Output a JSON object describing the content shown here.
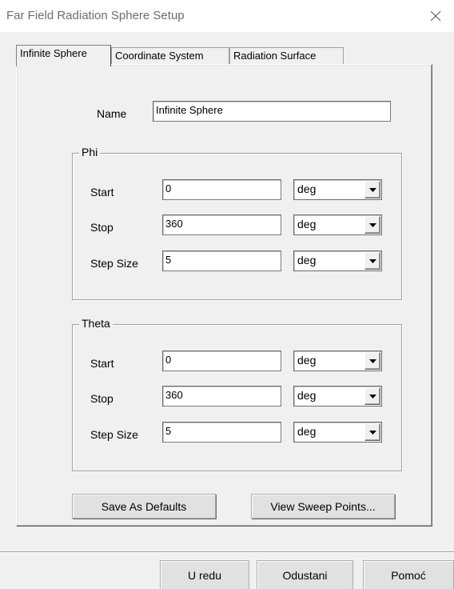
{
  "window": {
    "title": "Far Field Radiation Sphere Setup",
    "close_icon": "close-icon"
  },
  "tabs": [
    {
      "label": "Infinite Sphere",
      "active": true
    },
    {
      "label": "Coordinate System",
      "active": false
    },
    {
      "label": "Radiation Surface",
      "active": false
    }
  ],
  "name_field": {
    "label": "Name",
    "value": "Infinite Sphere"
  },
  "phi": {
    "legend": "Phi",
    "start": {
      "label": "Start",
      "value": "0",
      "unit": "deg"
    },
    "stop": {
      "label": "Stop",
      "value": "360",
      "unit": "deg"
    },
    "step": {
      "label": "Step Size",
      "value": "5",
      "unit": "deg"
    }
  },
  "theta": {
    "legend": "Theta",
    "start": {
      "label": "Start",
      "value": "0",
      "unit": "deg"
    },
    "stop": {
      "label": "Stop",
      "value": "360",
      "unit": "deg"
    },
    "step": {
      "label": "Step Size",
      "value": "5",
      "unit": "deg"
    }
  },
  "buttons": {
    "save_defaults": "Save As Defaults",
    "view_sweep": "View Sweep Points..."
  },
  "footer": {
    "ok": "U redu",
    "cancel": "Odustani",
    "help": "Pomoć"
  }
}
